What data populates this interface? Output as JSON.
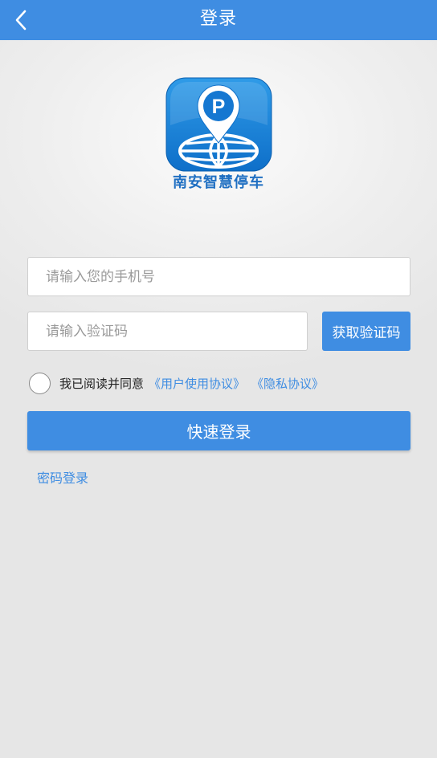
{
  "header": {
    "title": "登录",
    "back_icon": "chevron-left-icon",
    "background_color": "#3f8de2"
  },
  "logo": {
    "icon": "parking-location-globe-icon",
    "app_name": "南安智慧停车"
  },
  "form": {
    "phone_placeholder": "请输入您的手机号",
    "code_placeholder": "请输入验证码",
    "get_code_label": "获取验证码",
    "agree_text": "我已阅读并同意",
    "user_agreement_link": "《用户使用协议》",
    "privacy_link": "《隐私协议》",
    "agree_checked": false,
    "login_button": "快速登录",
    "password_login_link": "密码登录"
  },
  "colors": {
    "accent": "#3f8de2",
    "logo_text": "#1f6fc2"
  }
}
